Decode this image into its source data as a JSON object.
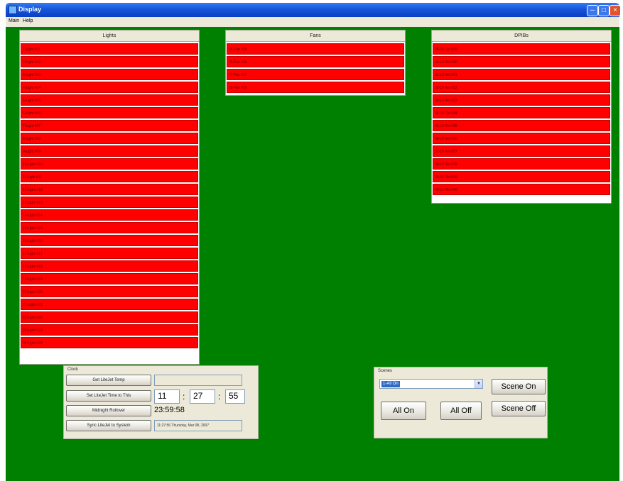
{
  "window": {
    "title": "Display"
  },
  "menu": [
    "Main",
    "Help"
  ],
  "groups": {
    "lights": {
      "header": "Lights",
      "items": [
        "1-Light #01",
        "2-Light #02",
        "3-Light #03",
        "4-Light #04",
        "5-Light #05",
        "6-Light #06",
        "7-Light #07",
        "8-Light #08",
        "9-Light #09",
        "10-Light #10",
        "11-Light #11",
        "12-Light #12",
        "13-Light #13",
        "14-Light #14",
        "15-Light #15",
        "16-Light #16",
        "17-Light #17",
        "18-Light #18",
        "19-Light #19",
        "20-Light #20",
        "21-Light #21",
        "22-Light #22",
        "23-Light #23",
        "24-Light #24"
      ]
    },
    "fans": {
      "header": "Fans",
      "items": [
        "25-Fan #25",
        "26-Fan #26",
        "27-Fan #27",
        "28-Fan #28"
      ]
    },
    "dpibs": {
      "header": "DPIBs",
      "items": [
        "29-LV Rel #29",
        "30-LV Rel #30",
        "31-LV Rel #31",
        "32-LV Rel #32",
        "33-LV Rel #33",
        "34-LV Rel #34",
        "35-LV Rel #35",
        "36-LV Rel #36",
        "37-LV Rel #37",
        "38-LV Rel #38",
        "39-LV Rel #39",
        "40-LV Rel #40"
      ]
    }
  },
  "clock": {
    "label": "Clock",
    "get_temp": "Get LiteJet Temp",
    "set_time": "Set LiteJet Time to This",
    "midnight": "Midnight Rollover",
    "sync": "Sync LiteJet to System",
    "hour": "11",
    "minute": "27",
    "second": "55",
    "colon": ":",
    "readout": "23:59:58",
    "system_time": "11:27:56  Thursday, Mar 08, 2007"
  },
  "scenes": {
    "label": "Scenes",
    "selected": "1-All On",
    "scene_on": "Scene On",
    "scene_off": "Scene Off",
    "all_on": "All On",
    "all_off": "All Off"
  }
}
